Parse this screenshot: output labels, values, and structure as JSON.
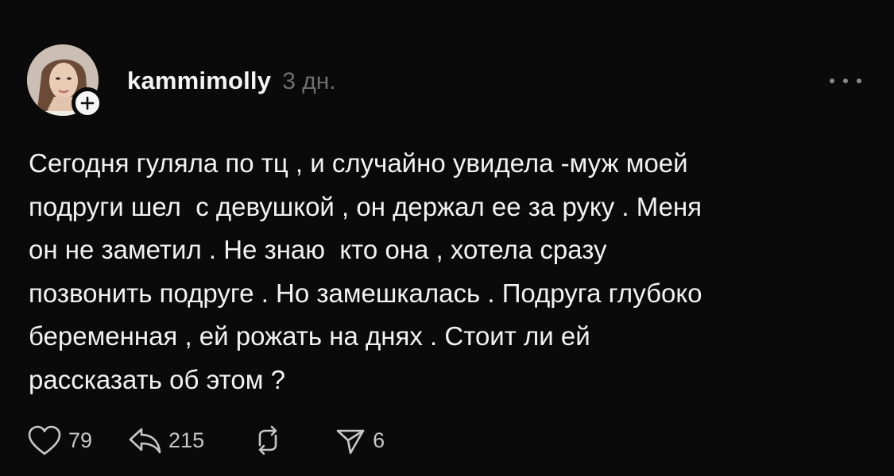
{
  "post": {
    "username": "kammimolly",
    "timestamp": "3 дн.",
    "body": "Сегодня гуляла по тц , и случайно увидела -муж моей\nподруги шел  с девушкой , он держал ее за руку . Меня\nон не заметил . Не знаю  кто она , хотела сразу\nпозвонить подруге . Но замешкалась . Подруга глубоко\nбеременная , ей рожать на днях . Стоит ли ей\nрассказать об этом ?",
    "avatar_icon": "user-avatar-photo",
    "follow_icon": "plus-icon"
  },
  "actions": {
    "likes": "79",
    "comments": "215",
    "reposts": "",
    "shares": "6"
  },
  "colors": {
    "background": "#0a0a0a",
    "text": "#f2f2f2",
    "muted": "#6e6e6e",
    "icon": "#c8c8c8"
  }
}
